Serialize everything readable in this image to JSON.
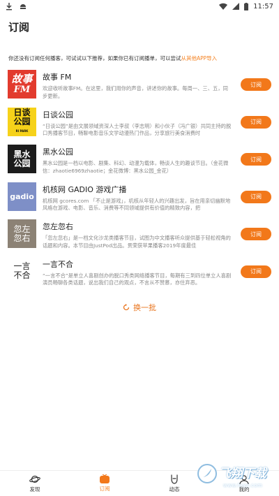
{
  "status_bar": {
    "time": "11:57"
  },
  "header": {
    "title": "订阅"
  },
  "notice": {
    "text": "你还没有订阅任何播客，可试试以下推荐，如果你已有订阅播单，可以尝试",
    "link": "从其他APP导入"
  },
  "podcasts": [
    {
      "title": "故事 FM",
      "desc": "欢迎收听故事FM。在这里，我们用你的声音，讲述你的故事。每周一、三、五，同步更新。",
      "subscribe_label": "订阅",
      "cover": {
        "text_top": "故事",
        "text_bottom": "FM",
        "bg": "#e23b2e",
        "fg": "#ffffff"
      }
    },
    {
      "title": "日谈公园",
      "desc": "“日谈公园”是由文展领域资深人士李叔（李志明）和小伙子（冯广银）共同主持的脱口秀播客节目，畅聊电影音乐文学动漫热门作品，分享旅行美食消费时",
      "subscribe_label": "订阅",
      "cover": {
        "text_top": "日谈",
        "text_bottom": "公园",
        "bg": "#f6d21a",
        "fg": "#111111",
        "sub": "RI PARK"
      }
    },
    {
      "title": "黑水公园",
      "desc": "黑水公园是一档以电影、剧集、科幻、动漫为载体，畅谈人生的趣谈节目。（金花微信：zhaotie6969zhaotie；金花微博：黑水公园_金花）",
      "subscribe_label": "订阅",
      "cover": {
        "text_top": "黑水",
        "text_bottom": "公园",
        "bg": "#1c1c1c",
        "fg": "#ffffff"
      }
    },
    {
      "title": "机核网 GADIO 游戏广播",
      "desc": "机核网 gcores.com 「不止是游戏」，机核从年轻人的兴趣出发，旨在用亲切幽默地风格在游戏、电影、音乐、消费等不同领域提供有价值的精致内容，把",
      "subscribe_label": "订阅",
      "cover": {
        "text_top": "gadio",
        "text_bottom": "",
        "bg": "#7e8fc7",
        "fg": "#ffffff"
      }
    },
    {
      "title": "忽左忽右",
      "desc": "「忽左忽右」是一档文化沙龙类播客节目，试图为中文播客听众提供基于轻松视角的话题和内容。本节目由JustPod出品。贯荣获苹果播客2019年度最佳",
      "subscribe_label": "订阅",
      "cover": {
        "text_top": "忽左",
        "text_bottom": "忽右",
        "bg": "#8c8275",
        "fg": "#ffffff"
      }
    },
    {
      "title": "一言不合",
      "desc": "“一言不合”是单立人喜剧创办的脱口秀类网络播客节目，每期有三到四位单立人喜剧演员畅聊各类话题，说出我们自己的观点，不言从不赞慕，亦住弃恶。",
      "subscribe_label": "订阅",
      "cover": {
        "text_top": "一言",
        "text_bottom": "不合",
        "bg": "#ffffff",
        "fg": "#222222"
      }
    }
  ],
  "refresh": {
    "label": "换一批"
  },
  "bottom_nav": [
    {
      "label": "发现",
      "icon": "planet-icon",
      "active": false
    },
    {
      "label": "订阅",
      "icon": "subscribe-icon",
      "active": true
    },
    {
      "label": "动态",
      "icon": "rock-hand-icon",
      "active": false
    },
    {
      "label": "我的",
      "icon": "profile-icon",
      "active": false
    }
  ],
  "watermark": {
    "text": "飞翔下载",
    "url": "www.fxxz.com"
  },
  "colors": {
    "accent": "#f2781a",
    "link": "#f4801f"
  }
}
